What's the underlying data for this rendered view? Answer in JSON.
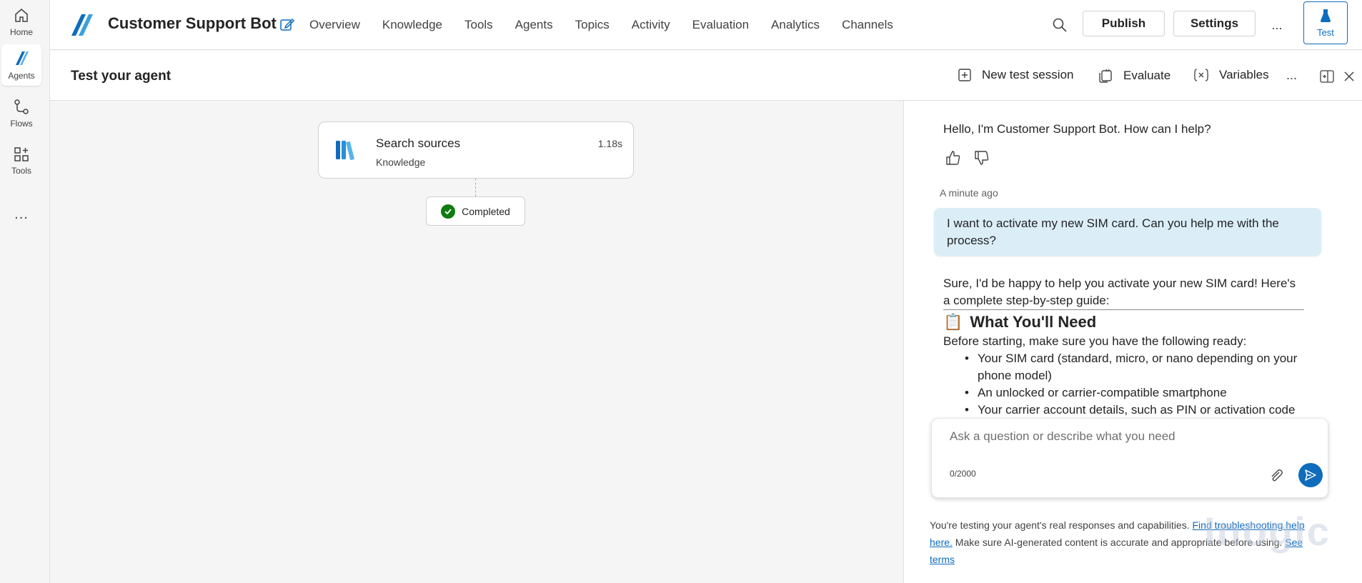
{
  "rail": {
    "home": "Home",
    "agents": "Agents",
    "flows": "Flows",
    "tools": "Tools",
    "more": "..."
  },
  "header": {
    "title": "Customer Support Bot",
    "nav": [
      "Overview",
      "Knowledge",
      "Tools",
      "Agents",
      "Topics",
      "Activity",
      "Evaluation",
      "Analytics",
      "Channels"
    ],
    "publish": "Publish",
    "settings": "Settings",
    "more": "...",
    "test": "Test"
  },
  "test_panel": {
    "title": "Test your agent",
    "new_session": "New test session",
    "evaluate": "Evaluate",
    "variables": "Variables",
    "more": "..."
  },
  "canvas": {
    "node_title": "Search sources",
    "node_subtitle": "Knowledge",
    "node_time": "1.18s",
    "status": "Completed"
  },
  "chat": {
    "greeting": "Hello, I'm Customer Support Bot. How can I help?",
    "timestamp": "A minute ago",
    "user_message": "I want to activate my new SIM card. Can you help me with the process?",
    "response_intro": "Sure, I'd be happy to help you activate your new SIM card! Here's a complete step-by-step guide:",
    "response_heading": "What You'll Need",
    "response_heading_emoji": "📋",
    "response_pre_list": "Before starting, make sure you have the following ready:",
    "response_list": [
      "Your SIM card (standard, micro, or nano depending on your phone model)",
      "An unlocked or carrier-compatible smartphone",
      "Your carrier account details, such as PIN or activation code"
    ],
    "input_placeholder": "Ask a question or describe what you need",
    "counter": "0/2000"
  },
  "disclaimer": {
    "text1": "You're testing your agent's real responses and capabilities. ",
    "link1": "Find troubleshooting help here.",
    "text2": " Make sure AI-generated content is accurate and appropriate before using. ",
    "link2": "See terms"
  },
  "watermark": "Inogic",
  "colors": {
    "accent": "#0f6cbd",
    "user_bubble": "#dbeef8",
    "success": "#107c10"
  }
}
